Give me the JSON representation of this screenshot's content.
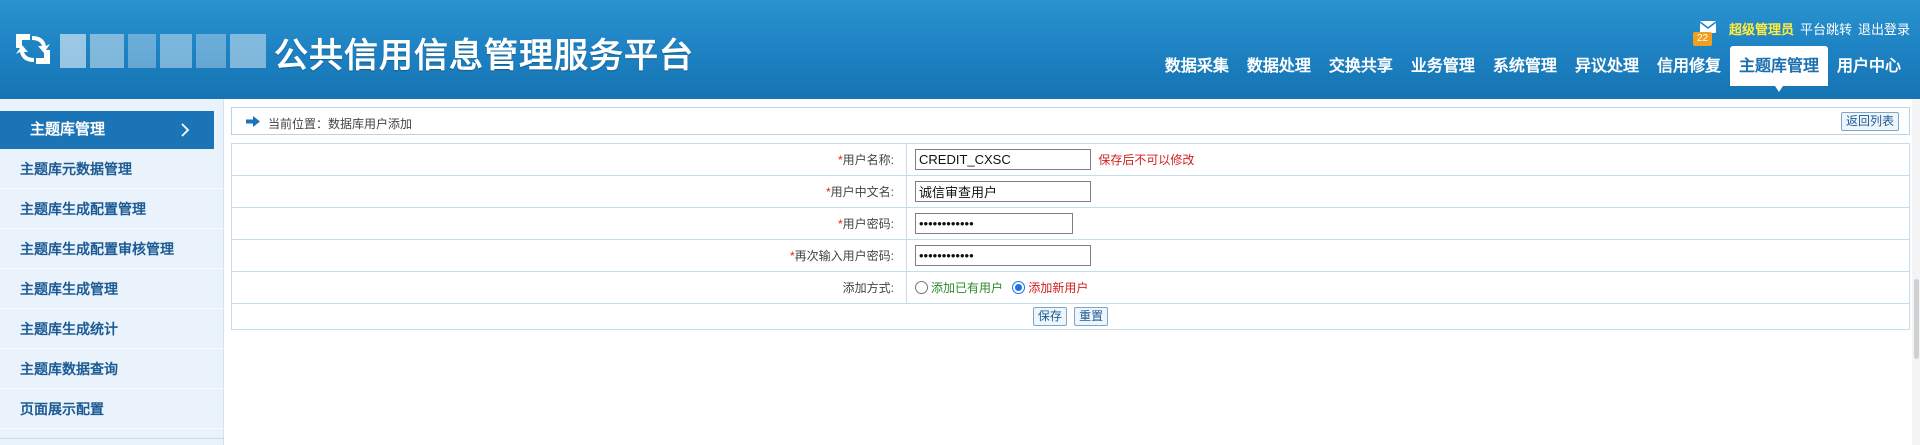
{
  "header": {
    "title": "公共信用信息管理服务平台",
    "mail_count": "22",
    "user_role": "超级管理员",
    "platform_switch": "平台跳转",
    "logout": "退出登录",
    "accent_color": "#1f84c4"
  },
  "nav": {
    "items": [
      {
        "label": "数据采集"
      },
      {
        "label": "数据处理"
      },
      {
        "label": "交换共享"
      },
      {
        "label": "业务管理"
      },
      {
        "label": "系统管理"
      },
      {
        "label": "异议处理"
      },
      {
        "label": "信用修复"
      },
      {
        "label": "主题库管理",
        "active": true
      },
      {
        "label": "用户中心"
      }
    ]
  },
  "sidebar": {
    "header": "主题库管理",
    "items": [
      {
        "label": "主题库元数据管理"
      },
      {
        "label": "主题库生成配置管理"
      },
      {
        "label": "主题库生成配置审核管理"
      },
      {
        "label": "主题库生成管理"
      },
      {
        "label": "主题库生成统计"
      },
      {
        "label": "主题库数据查询"
      },
      {
        "label": "页面展示配置"
      }
    ]
  },
  "breadcrumb": {
    "text": "当前位置：数据库用户添加",
    "back_label": "返回列表"
  },
  "form": {
    "username": {
      "label": "用户名称:",
      "value": "CREDIT_CXSC",
      "hint": "保存后不可以修改"
    },
    "cn_name": {
      "label": "用户中文名:",
      "value": "诚信审查用户"
    },
    "password": {
      "label": "用户密码:",
      "value": "••••••••••••"
    },
    "password_confirm": {
      "label": "再次输入用户密码:",
      "value": "••••••••••••"
    },
    "add_mode": {
      "label": "添加方式:",
      "options": [
        {
          "label": "添加已有用户",
          "selected": false
        },
        {
          "label": "添加新用户",
          "selected": true
        }
      ]
    },
    "required_mark": "*",
    "save_label": "保存",
    "reset_label": "重置"
  }
}
